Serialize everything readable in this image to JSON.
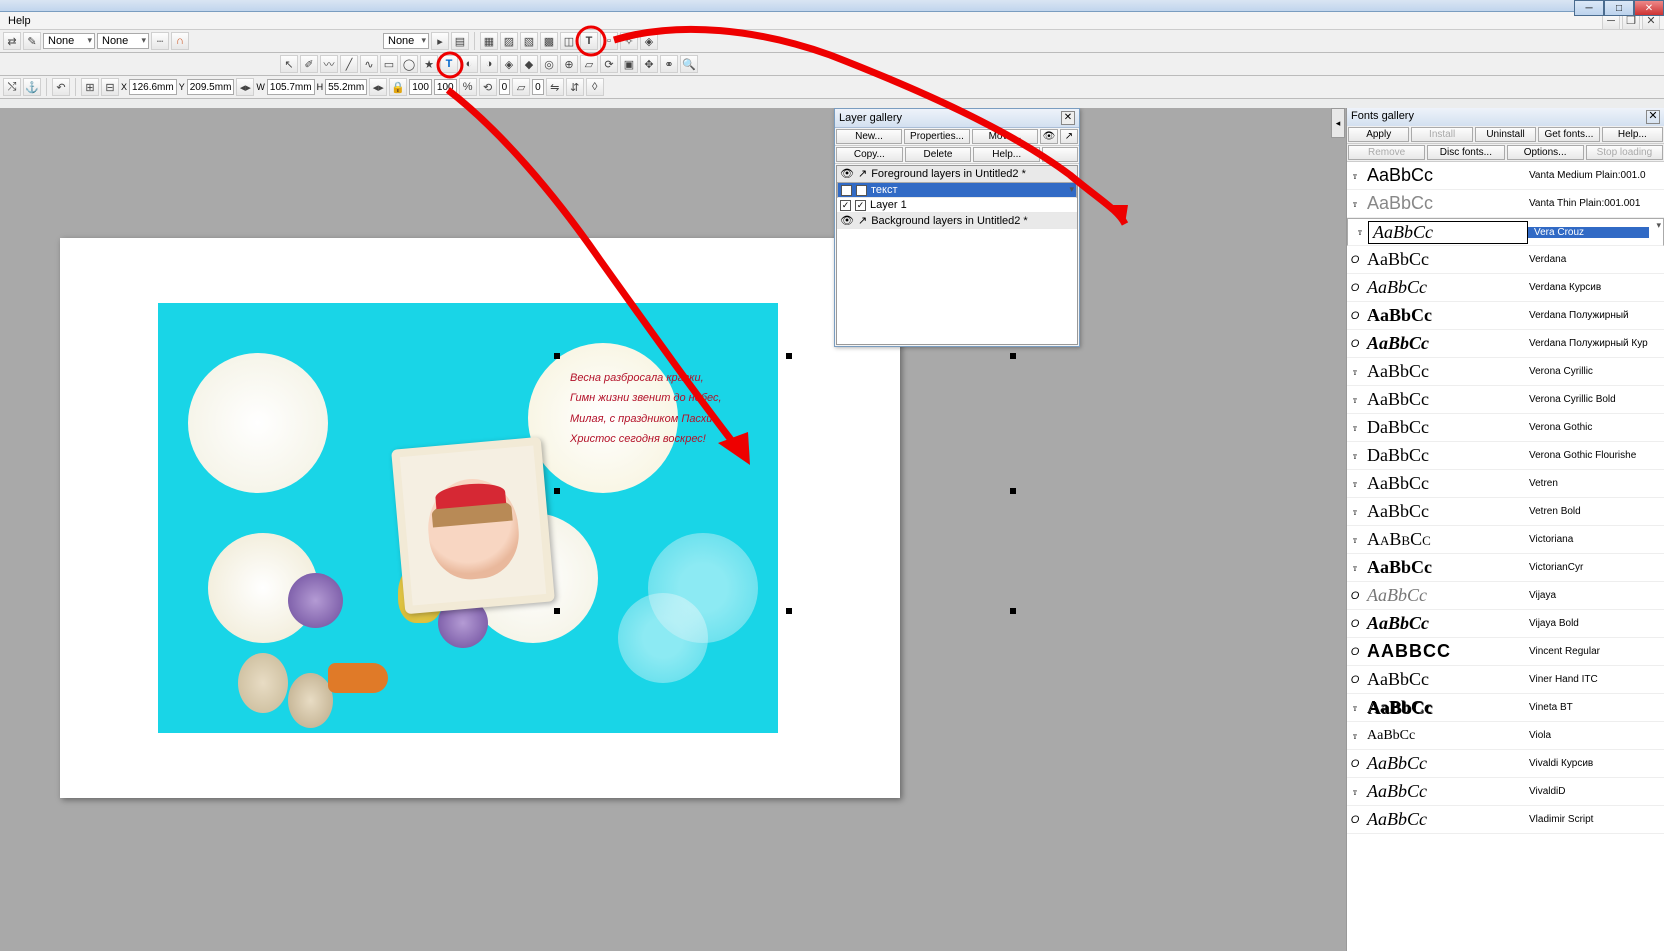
{
  "menu": {
    "help": "Help"
  },
  "tool1": {
    "none1": "None",
    "none2": "None"
  },
  "coords": {
    "x": "126.6mm",
    "y": "209.5mm",
    "w": "105.7mm",
    "h": "55.2mm",
    "p1": "100",
    "p2": "100",
    "ang": "0",
    "sp": "0"
  },
  "layer_gallery": {
    "title": "Layer gallery",
    "new": "New...",
    "properties": "Properties...",
    "move": "Move...",
    "copy": "Copy...",
    "delete": "Delete",
    "help": "Help...",
    "fg": "Foreground layers in Untitled2 *",
    "r1": "текст",
    "r2": "Layer 1",
    "bg": "Background layers in Untitled2 *"
  },
  "fonts_gallery": {
    "title": "Fonts gallery",
    "apply": "Apply",
    "install": "Install",
    "uninstall": "Uninstall",
    "getfonts": "Get fonts...",
    "help": "Help...",
    "remove": "Remove",
    "discfonts": "Disc fonts...",
    "options": "Options...",
    "stop": "Stop loading",
    "list": [
      {
        "ico": "T",
        "samp": "AaBbCc",
        "name": "Vanta Medium Plain:001.0",
        "style": "font-family:sans-serif;"
      },
      {
        "ico": "T",
        "samp": "AaBbCc",
        "name": "Vanta Thin Plain:001.001",
        "style": "font-family:sans-serif;font-weight:300;color:#888;"
      },
      {
        "ico": "T",
        "samp": "AaBbCc",
        "name": "Vera Crouz",
        "style": "font-family:'Brush Script MT',cursive;font-style:italic;",
        "sel": true
      },
      {
        "ico": "O",
        "samp": "AaBbCc",
        "name": "Verdana",
        "style": "font-family:Verdana;"
      },
      {
        "ico": "O",
        "samp": "AaBbCc",
        "name": "Verdana Курсив",
        "style": "font-family:Verdana;font-style:italic;"
      },
      {
        "ico": "O",
        "samp": "AaBbCc",
        "name": "Verdana Полужирный",
        "style": "font-family:Verdana;font-weight:bold;"
      },
      {
        "ico": "O",
        "samp": "AaBbCc",
        "name": "Verdana Полужирный Кур",
        "style": "font-family:Verdana;font-weight:bold;font-style:italic;"
      },
      {
        "ico": "T",
        "samp": "AaBbCc",
        "name": "Verona Cyrillic",
        "style": "font-family:Georgia;"
      },
      {
        "ico": "T",
        "samp": "AaBbCc",
        "name": "Verona Cyrillic Bold",
        "style": "font-family:Georgia;"
      },
      {
        "ico": "T",
        "samp": "DaBbCc",
        "name": "Verona Gothic",
        "style": "font-family:'Old English Text MT',serif;"
      },
      {
        "ico": "T",
        "samp": "DaBbCc",
        "name": "Verona Gothic Flourishe",
        "style": "font-family:'Old English Text MT',serif;"
      },
      {
        "ico": "T",
        "samp": "AaBbCc",
        "name": "Vetren",
        "style": "font-family:'Times New Roman';"
      },
      {
        "ico": "T",
        "samp": "AaBbCc",
        "name": "Vetren Bold",
        "style": "font-family:'Times New Roman';"
      },
      {
        "ico": "T",
        "samp": "AaBbCc",
        "name": "Victoriana",
        "style": "font-family:serif;font-variant:small-caps;"
      },
      {
        "ico": "T",
        "samp": "AaBbCc",
        "name": "VictorianCyr",
        "style": "font-family:serif;font-weight:bold;"
      },
      {
        "ico": "O",
        "samp": "AaBbCc",
        "name": "Vijaya",
        "style": "font-family:serif;font-style:italic;color:#777;"
      },
      {
        "ico": "O",
        "samp": "AaBbCc",
        "name": "Vijaya Bold",
        "style": "font-family:serif;font-style:italic;font-weight:bold;"
      },
      {
        "ico": "O",
        "samp": "AABBCC",
        "name": "Vincent Regular",
        "style": "font-family:sans-serif;font-weight:900;letter-spacing:1px;"
      },
      {
        "ico": "O",
        "samp": "AaBbCc",
        "name": "Viner Hand ITC",
        "style": "font-family:'Brush Script MT',cursive;"
      },
      {
        "ico": "T",
        "samp": "AaBbCc",
        "name": "Vineta BT",
        "style": "font-family:serif;font-weight:900;text-shadow:1px 1px 0 #000;"
      },
      {
        "ico": "T",
        "samp": "AaBbCc",
        "name": "Viola",
        "style": "font-family:serif;font-size:14px;"
      },
      {
        "ico": "O",
        "samp": "AaBbCc",
        "name": "Vivaldi Курсив",
        "style": "font-family:'Brush Script MT',cursive;font-style:italic;"
      },
      {
        "ico": "T",
        "samp": "AaBbCc",
        "name": "VivaldiD",
        "style": "font-family:'Brush Script MT',cursive;font-style:italic;"
      },
      {
        "ico": "O",
        "samp": "AaBbCc",
        "name": "Vladimir Script",
        "style": "font-family:'Brush Script MT',cursive;font-style:italic;"
      }
    ]
  },
  "poem": {
    "l1": "Весна разбросала краски,",
    "l2": "Гимн жизни звенит до небес,",
    "l3": "Милая, с праздником Пасхи -",
    "l4": "Христос сегодня воскрес!"
  }
}
